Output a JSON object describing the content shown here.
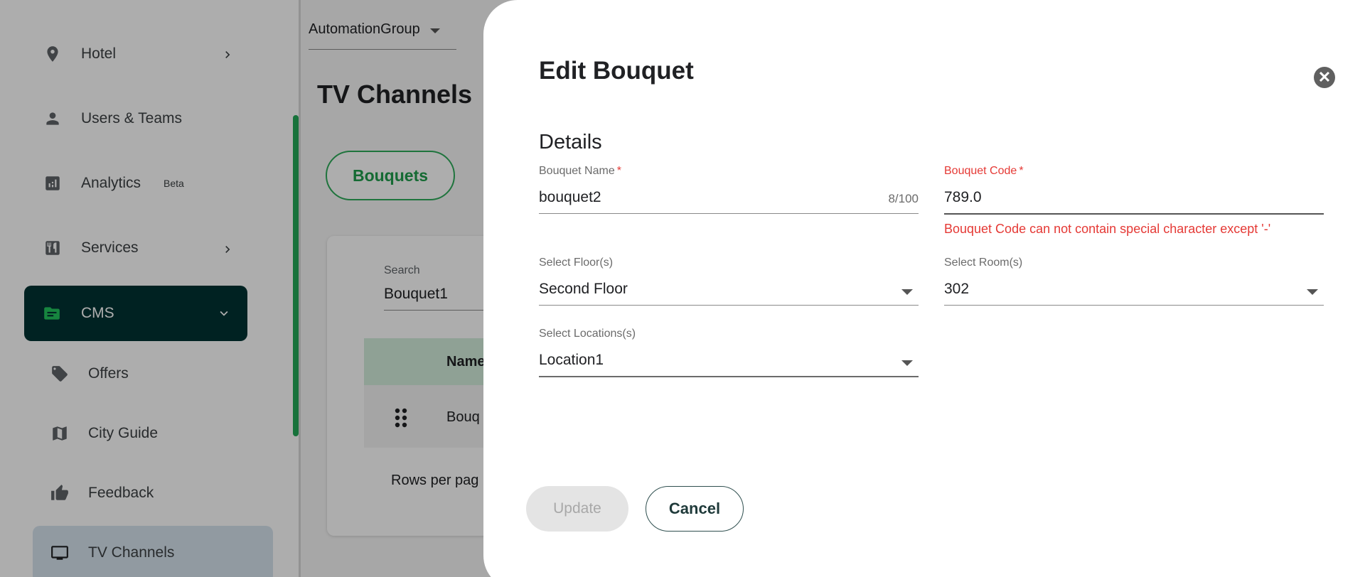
{
  "sidebar": {
    "items": [
      {
        "label": "Hotel",
        "icon": "location-pin-icon"
      },
      {
        "label": "Users & Teams",
        "icon": "person-icon"
      },
      {
        "label": "Analytics",
        "icon": "analytics-icon",
        "badge": "Beta"
      },
      {
        "label": "Services",
        "icon": "cutlery-icon"
      },
      {
        "label": "CMS",
        "icon": "folder-icon",
        "active": true
      },
      {
        "label": "Offers",
        "icon": "tag-icon"
      },
      {
        "label": "City Guide",
        "icon": "map-icon"
      },
      {
        "label": "Feedback",
        "icon": "thumb-up-icon"
      },
      {
        "label": "TV Channels",
        "icon": "tv-icon",
        "selected": true
      }
    ]
  },
  "header": {
    "group_select": "AutomationGroup"
  },
  "page": {
    "title": "TV Channels",
    "tab": "Bouquets",
    "search_label": "Search",
    "search_value": "Bouquet1",
    "table_header_name": "Name",
    "row_name": "Bouq",
    "rows_per_page": "Rows per pag"
  },
  "modal": {
    "title": "Edit Bouquet",
    "section": "Details",
    "bouquet_name": {
      "label": "Bouquet Name",
      "required_mark": "*",
      "value": "bouquet2",
      "counter": "8/100"
    },
    "bouquet_code": {
      "label": "Bouquet Code",
      "required_mark": "*",
      "value": "789.0",
      "error": "Bouquet Code can not contain special character except '-'"
    },
    "floor": {
      "label": "Select Floor(s)",
      "value": "Second Floor"
    },
    "room": {
      "label": "Select Room(s)",
      "value": "302"
    },
    "location": {
      "label": "Select Locations(s)",
      "value": "Location1"
    },
    "update_label": "Update",
    "cancel_label": "Cancel",
    "close_glyph": "✕"
  },
  "colors": {
    "accent": "#22a857",
    "active_nav_bg": "#003333",
    "error": "#e53935"
  }
}
